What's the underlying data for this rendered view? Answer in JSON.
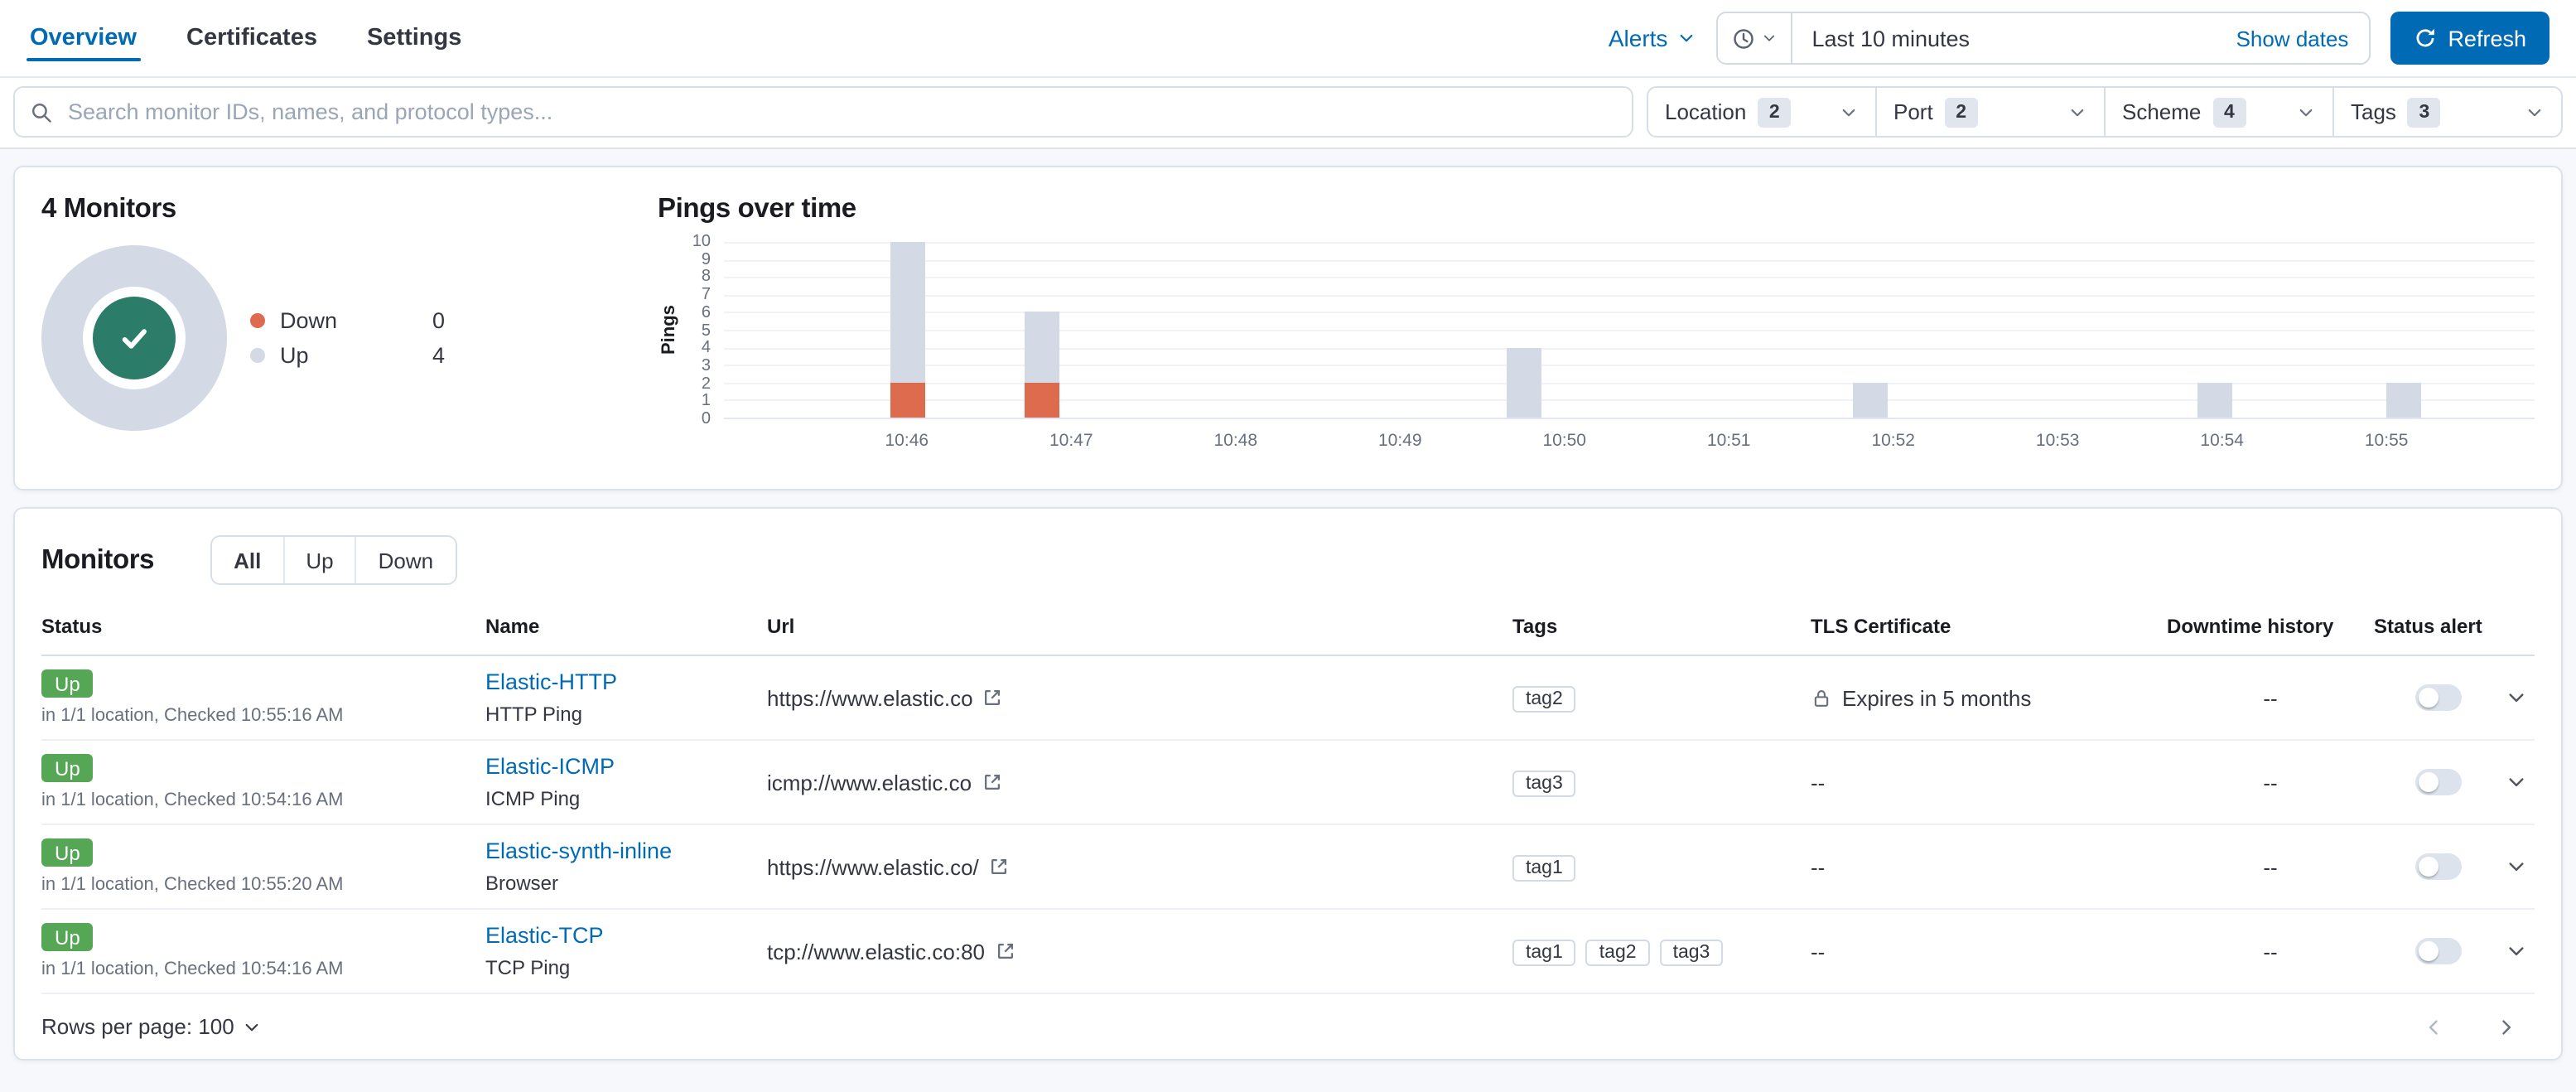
{
  "topnav": {
    "tabs": [
      {
        "label": "Overview",
        "active": true
      },
      {
        "label": "Certificates",
        "active": false
      },
      {
        "label": "Settings",
        "active": false
      }
    ],
    "alerts_label": "Alerts",
    "time_value": "Last 10 minutes",
    "show_dates_label": "Show dates",
    "refresh_label": "Refresh"
  },
  "filter_bar": {
    "search_placeholder": "Search monitor IDs, names, and protocol types...",
    "filters": [
      {
        "label": "Location",
        "count": "2"
      },
      {
        "label": "Port",
        "count": "2"
      },
      {
        "label": "Scheme",
        "count": "4"
      },
      {
        "label": "Tags",
        "count": "3"
      }
    ]
  },
  "overview_panel": {
    "title": "4 Monitors",
    "legend": [
      {
        "label": "Down",
        "value": "0",
        "color": "#DD6B4E"
      },
      {
        "label": "Up",
        "value": "4",
        "color": "#D3DAE6"
      }
    ]
  },
  "chart_data": {
    "type": "bar",
    "stacked": true,
    "title": "Pings over time",
    "xlabel": "",
    "ylabel": "Pings",
    "ylim": [
      0,
      10
    ],
    "yticks": [
      0,
      1,
      2,
      3,
      4,
      5,
      6,
      7,
      8,
      9,
      10
    ],
    "xticks": [
      "10:46",
      "10:47",
      "10:48",
      "10:49",
      "10:50",
      "10:51",
      "10:52",
      "10:53",
      "10:54",
      "10:55"
    ],
    "grid": true,
    "legend_position": "none",
    "series": [
      {
        "name": "Up",
        "color": "#D3DAE6"
      },
      {
        "name": "Down",
        "color": "#DD6B4E"
      }
    ],
    "bars": [
      {
        "time": "10:46",
        "frac": 0.102,
        "up": 8,
        "down": 2
      },
      {
        "time": "10:47",
        "frac": 0.176,
        "up": 4,
        "down": 2
      },
      {
        "time": "10:50",
        "frac": 0.442,
        "up": 4,
        "down": 0
      },
      {
        "time": "10:52",
        "frac": 0.633,
        "up": 2,
        "down": 0
      },
      {
        "time": "10:54",
        "frac": 0.823,
        "up": 2,
        "down": 0
      },
      {
        "time": "10:55",
        "frac": 0.928,
        "up": 2,
        "down": 0
      }
    ]
  },
  "monitors_panel": {
    "title": "Monitors",
    "view_options": [
      "All",
      "Up",
      "Down"
    ],
    "active_view": "All",
    "columns": [
      "Status",
      "Name",
      "Url",
      "Tags",
      "TLS Certificate",
      "Downtime history",
      "Status alert"
    ],
    "rows": [
      {
        "status": "Up",
        "status_detail": "in 1/1 location, Checked 10:55:16 AM",
        "name": "Elastic-HTTP",
        "monitor_type": "HTTP Ping",
        "url": "https://www.elastic.co",
        "tags": [
          "tag2"
        ],
        "tls": "Expires in 5 months",
        "tls_has_lock": true,
        "downtime_history": "--",
        "status_alert_enabled": false
      },
      {
        "status": "Up",
        "status_detail": "in 1/1 location, Checked 10:54:16 AM",
        "name": "Elastic-ICMP",
        "monitor_type": "ICMP Ping",
        "url": "icmp://www.elastic.co",
        "tags": [
          "tag3"
        ],
        "tls": "--",
        "tls_has_lock": false,
        "downtime_history": "--",
        "status_alert_enabled": false
      },
      {
        "status": "Up",
        "status_detail": "in 1/1 location, Checked 10:55:20 AM",
        "name": "Elastic-synth-inline",
        "monitor_type": "Browser",
        "url": "https://www.elastic.co/",
        "tags": [
          "tag1"
        ],
        "tls": "--",
        "tls_has_lock": false,
        "downtime_history": "--",
        "status_alert_enabled": false
      },
      {
        "status": "Up",
        "status_detail": "in 1/1 location, Checked 10:54:16 AM",
        "name": "Elastic-TCP",
        "monitor_type": "TCP Ping",
        "url": "tcp://www.elastic.co:80",
        "tags": [
          "tag1",
          "tag2",
          "tag3"
        ],
        "tls": "--",
        "tls_has_lock": false,
        "downtime_history": "--",
        "status_alert_enabled": false
      }
    ],
    "rows_per_page_label": "Rows per page: 100"
  },
  "icons": {
    "search": "magnifier",
    "time_quick_select": "clock",
    "refresh": "refresh-arrow",
    "dropdown": "chevron-down",
    "url_external": "popout",
    "tls": "padlock",
    "all_up": "checkmark",
    "page_prev": "chevron-left",
    "page_next": "chevron-right"
  },
  "colors": {
    "primary": "#006BB4",
    "link": "#006BB4",
    "up_badge": "#55A655",
    "down": "#DD6B4E",
    "up_fill": "#D3DAE6",
    "donut_center": "#2B7C68",
    "border": "#D3DAE6",
    "border_light": "#ECEFF5",
    "text": "#343741",
    "text_subdued": "#69707D",
    "badge_bg": "#E0E5EE",
    "page_bg": "#F6F8FB"
  }
}
